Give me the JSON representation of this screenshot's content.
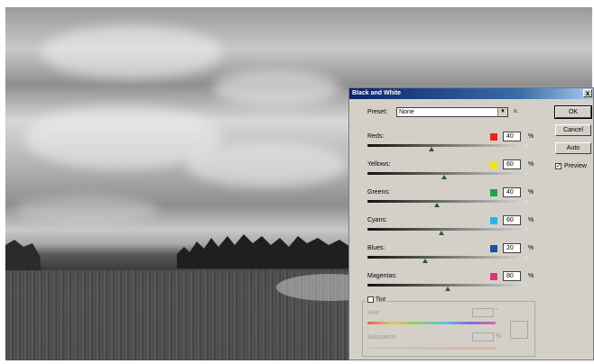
{
  "dialog": {
    "title": "Black and White",
    "close_glyph": "x",
    "preset": {
      "label": "Preset:",
      "value": "None",
      "menu_glyph": "▼",
      "options_icon_glyph": "≡,"
    },
    "buttons": {
      "ok": "OK",
      "cancel": "Cancel",
      "auto": "Auto"
    },
    "preview": {
      "label": "Preview",
      "checked": true,
      "check_glyph": "✓"
    },
    "sliders": [
      {
        "name": "Reds:",
        "value": "40",
        "percent": "%",
        "color": "#e8231e",
        "gradient": "linear-gradient(90deg,#111,#d9d9d9)",
        "pos": 0.4
      },
      {
        "name": "Yellows:",
        "value": "60",
        "percent": "%",
        "color": "#f5e20c",
        "gradient": "linear-gradient(90deg,#111,#d9d9d9)",
        "pos": 0.48
      },
      {
        "name": "Greens:",
        "value": "40",
        "percent": "%",
        "color": "#1fa24a",
        "gradient": "linear-gradient(90deg,#111,#d9d9d9)",
        "pos": 0.43
      },
      {
        "name": "Cyans:",
        "value": "60",
        "percent": "%",
        "color": "#22b4ea",
        "gradient": "linear-gradient(90deg,#111,#d9d9d9)",
        "pos": 0.46
      },
      {
        "name": "Blues:",
        "value": "20",
        "percent": "%",
        "color": "#1f4fa8",
        "gradient": "linear-gradient(90deg,#111,#d9d9d9)",
        "pos": 0.36
      },
      {
        "name": "Magentas:",
        "value": "80",
        "percent": "%",
        "color": "#e0337a",
        "gradient": "linear-gradient(90deg,#111,#d9d9d9)",
        "pos": 0.5
      }
    ],
    "tint": {
      "label": "Tint",
      "checked": false,
      "hue_label": "Hue",
      "hue_unit": "°",
      "saturation_label": "Saturation",
      "saturation_unit": "%",
      "hue_gradient": "linear-gradient(90deg,#e06666,#e0c466,#88d066,#66c0e0,#8866e0,#e066b0)",
      "sat_gradient": "linear-gradient(90deg,#c8c8c8,#d8b79a)"
    }
  }
}
